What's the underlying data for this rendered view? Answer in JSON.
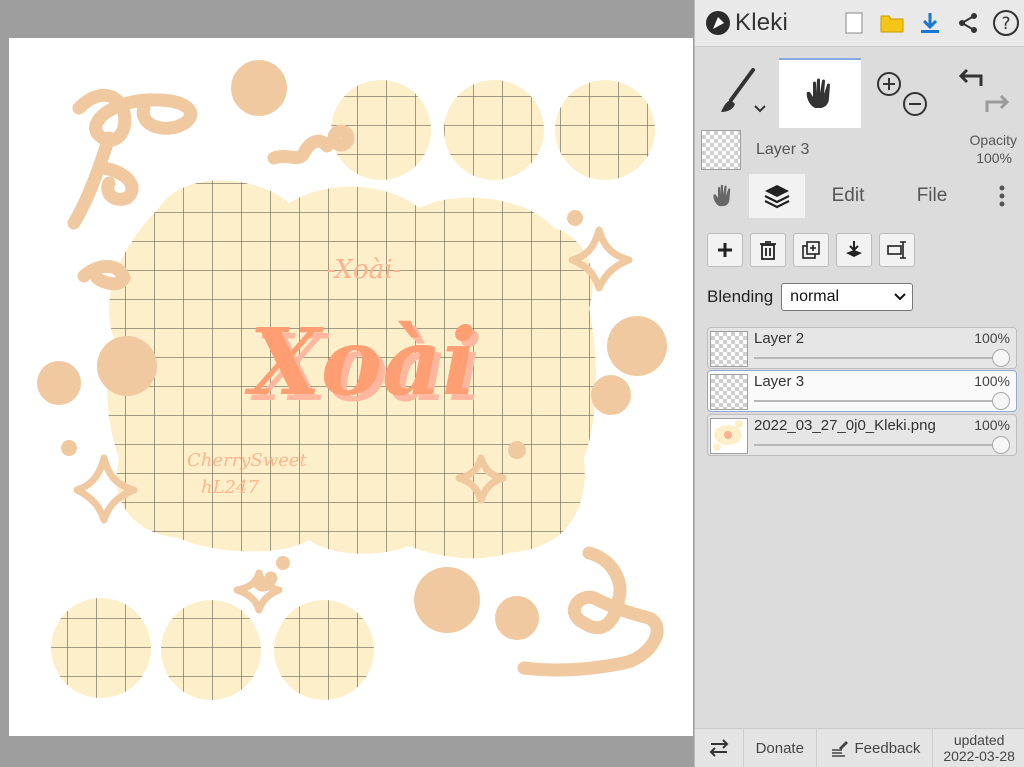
{
  "app": {
    "name": "Kleki"
  },
  "toolbar": {
    "icons": [
      "new-image-icon",
      "open-folder-icon",
      "download-icon",
      "share-icon",
      "help-icon"
    ],
    "tools": [
      "brush-icon",
      "hand-icon",
      "zoom-in-icon",
      "zoom-out-icon",
      "undo-icon",
      "redo-icon"
    ]
  },
  "current_layer": {
    "name": "Layer 3",
    "opacity_label": "Opacity",
    "opacity_value": "100%"
  },
  "tabs": {
    "edit": "Edit",
    "file": "File"
  },
  "layer_actions": [
    "add-layer",
    "delete-layer",
    "duplicate-layer",
    "merge-down",
    "rename-layer"
  ],
  "blending": {
    "label": "Blending",
    "value": "normal"
  },
  "layers": [
    {
      "name": "Layer 2",
      "opacity": "100%",
      "opacity_fraction": 1.0,
      "selected": false
    },
    {
      "name": "Layer 3",
      "opacity": "100%",
      "opacity_fraction": 1.0,
      "selected": true
    },
    {
      "name": "2022_03_27_0j0_Kleki.png",
      "opacity": "100%",
      "opacity_fraction": 1.0,
      "selected": false
    }
  ],
  "bottom": {
    "donate": "Donate",
    "feedback": "Feedback",
    "updated_label": "updated",
    "updated_date": "2022-03-28"
  },
  "artwork": {
    "small_title": "-Xoài-",
    "big_title": "Xoài",
    "signature_line1": "CherrySweet",
    "signature_line2": "hL247",
    "colors": {
      "pale_yellow": "#fdefc9",
      "tan": "#f1c9a0",
      "orange": "#ff9e73",
      "grid_line": "#6a6a5a"
    }
  },
  "colors": {
    "accent_blue": "#1976d2",
    "folder_yellow": "#f5c518"
  }
}
